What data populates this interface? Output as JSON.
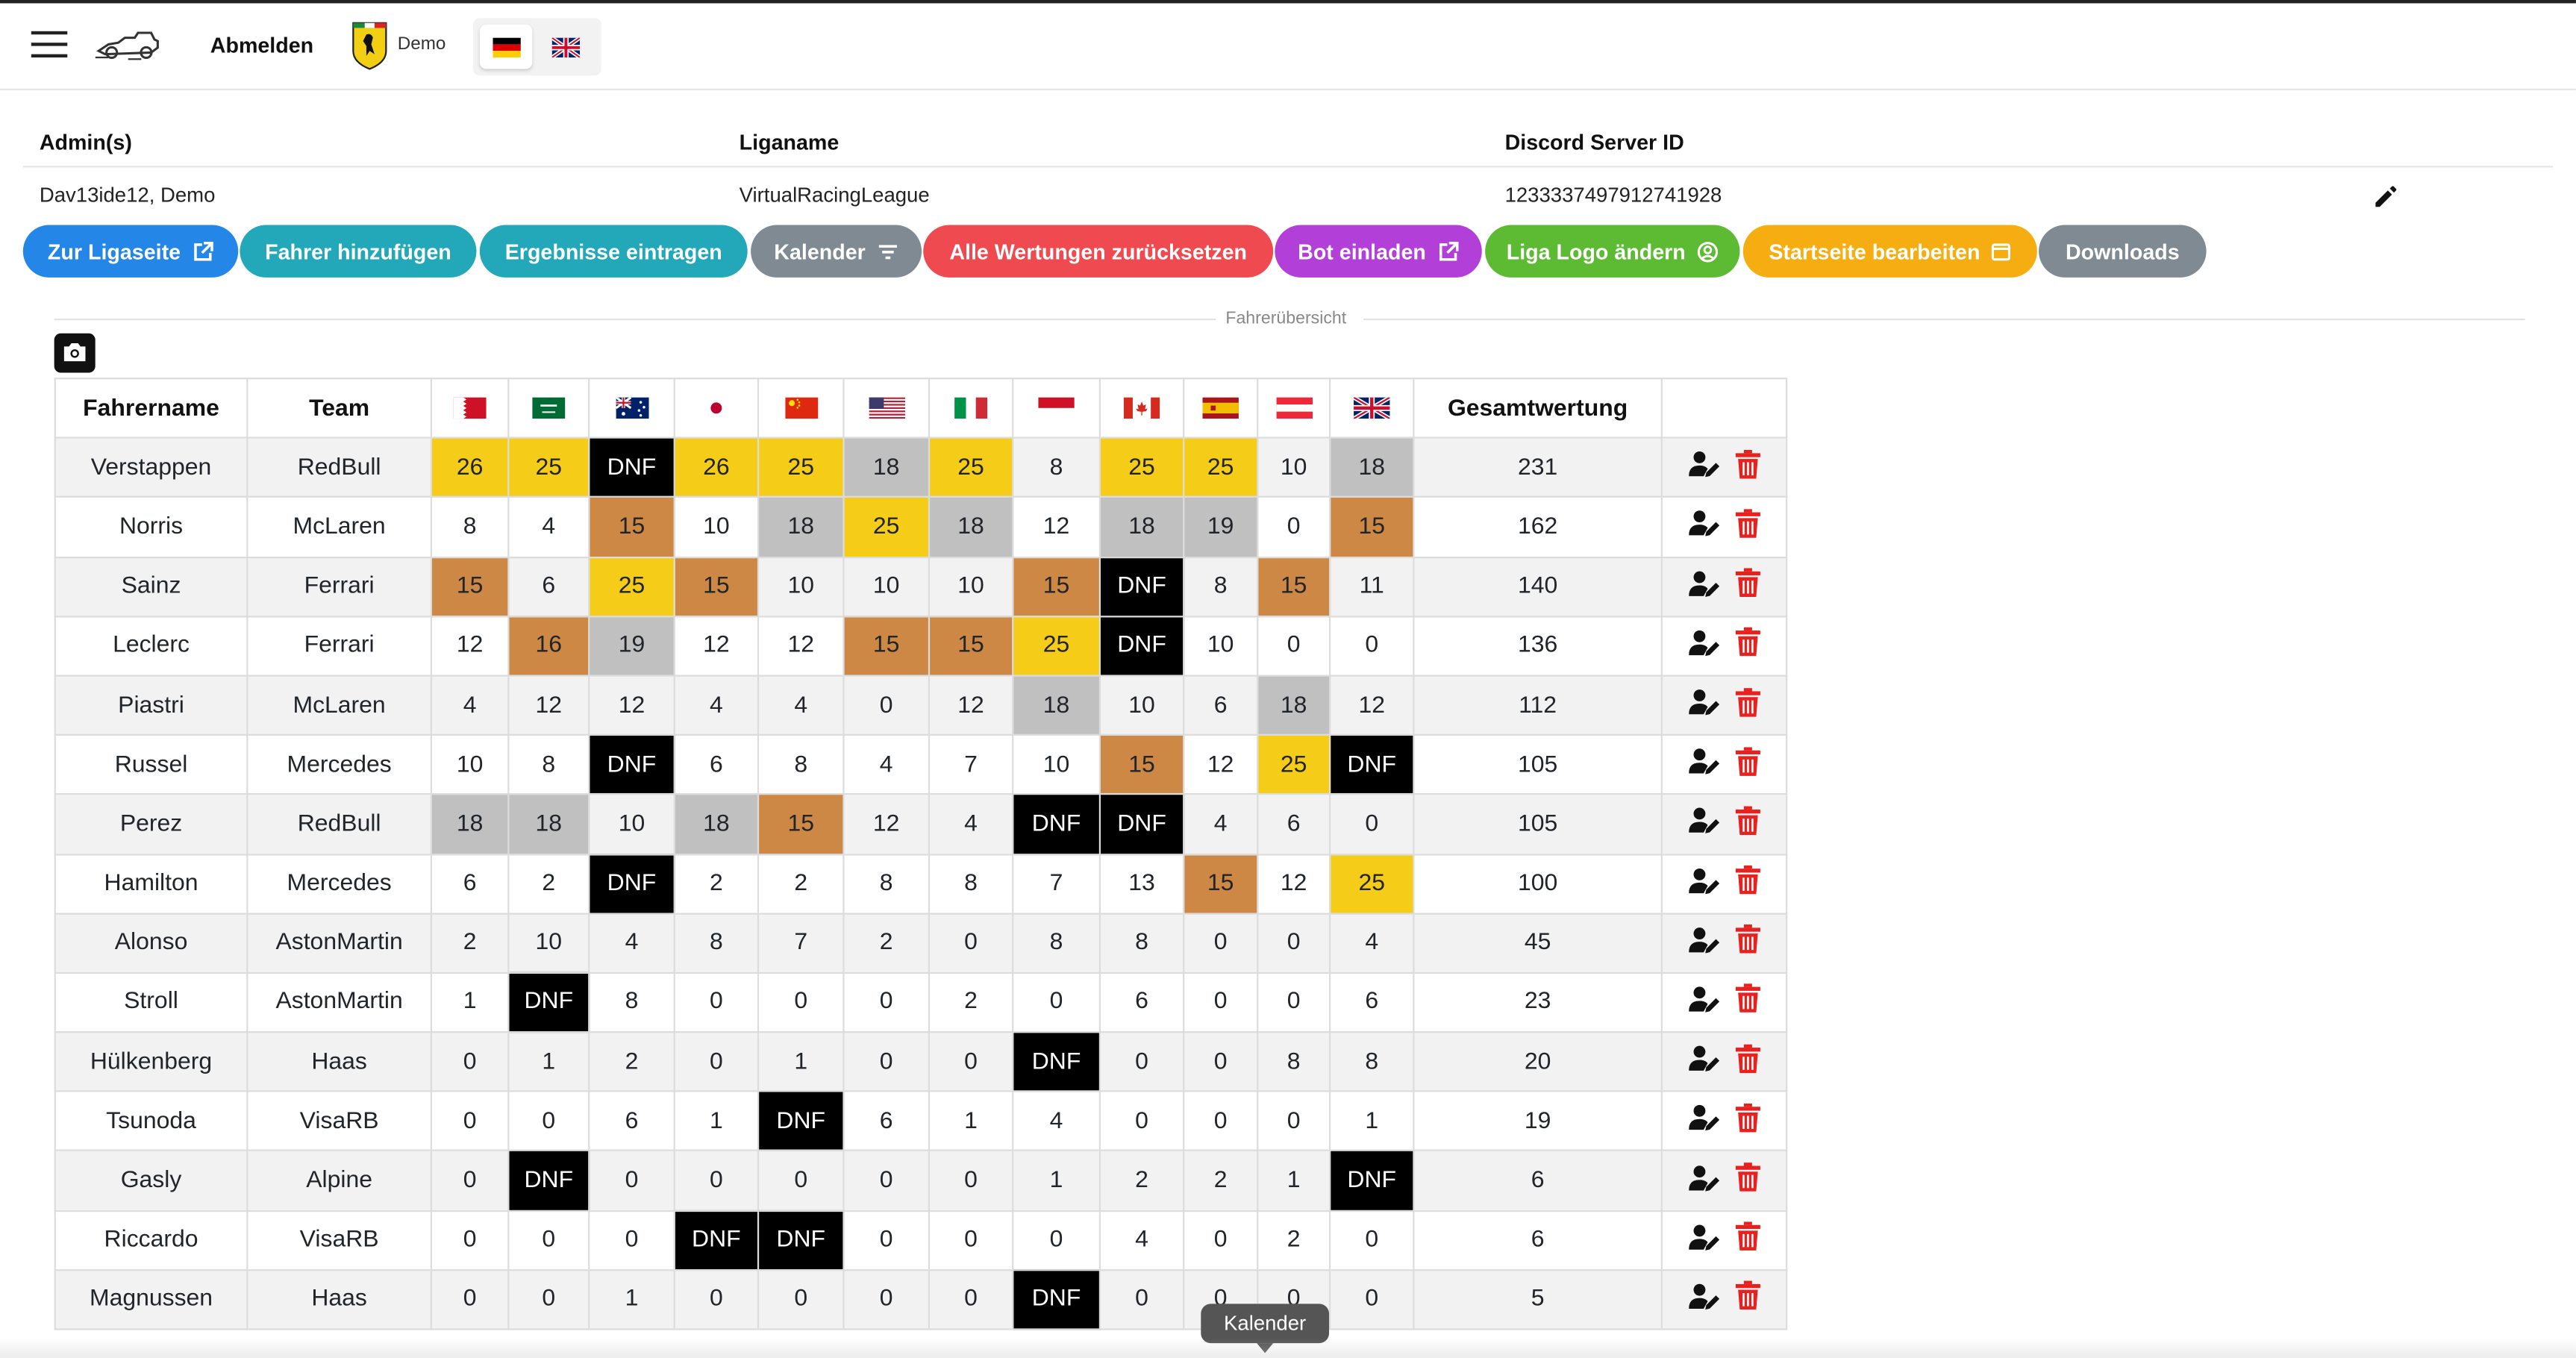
{
  "nav": {
    "logout_label": "Abmelden",
    "user_label": "Demo",
    "languages": [
      "de",
      "en"
    ],
    "active_language": "de"
  },
  "info": {
    "headers": {
      "admins": "Admin(s)",
      "league": "Liganame",
      "discord": "Discord Server ID"
    },
    "values": {
      "admins": "Dav13ide12, Demo",
      "league": "VirtualRacingLeague",
      "discord": "1233337497912741928"
    }
  },
  "buttons": [
    {
      "label": "Zur Ligaseite",
      "color": "#2487e8",
      "icon": "external-link-icon"
    },
    {
      "label": "Fahrer hinzufügen",
      "color": "#22a8b8",
      "icon": ""
    },
    {
      "label": "Ergebnisse eintragen",
      "color": "#22a8b8",
      "icon": ""
    },
    {
      "label": "Kalender",
      "color": "#7f8a93",
      "icon": "filter-icon"
    },
    {
      "label": "Alle Wertungen zurücksetzen",
      "color": "#ef4a4f",
      "icon": ""
    },
    {
      "label": "Bot einladen",
      "color": "#b23fd8",
      "icon": "external-link-icon"
    },
    {
      "label": "Liga Logo ändern",
      "color": "#5cba33",
      "icon": "user-circle-icon"
    },
    {
      "label": "Startseite bearbeiten",
      "color": "#f6ad11",
      "icon": "window-icon"
    },
    {
      "label": "Downloads",
      "color": "#7f8a93",
      "icon": ""
    }
  ],
  "section_title": "Fahrerübersicht",
  "table": {
    "headers": {
      "driver": "Fahrername",
      "team": "Team",
      "total": "Gesamtwertung"
    },
    "races": [
      "bahrain",
      "saudi-arabia",
      "australia",
      "japan",
      "china",
      "usa",
      "italy",
      "monaco",
      "canada",
      "spain",
      "austria",
      "great-britain"
    ],
    "rows": [
      {
        "driver": "Verstappen",
        "team": "RedBull",
        "results": [
          "26",
          "25",
          "DNF",
          "26",
          "25",
          "18",
          "25",
          "8",
          "25",
          "25",
          "10",
          "18"
        ],
        "styles": [
          "g",
          "g",
          "d",
          "g",
          "g",
          "s",
          "g",
          "",
          "g",
          "g",
          "",
          "s"
        ],
        "total": "231"
      },
      {
        "driver": "Norris",
        "team": "McLaren",
        "results": [
          "8",
          "4",
          "15",
          "10",
          "18",
          "25",
          "18",
          "12",
          "18",
          "19",
          "0",
          "15"
        ],
        "styles": [
          "",
          "",
          "b",
          "",
          "s",
          "g",
          "s",
          "",
          "s",
          "s",
          "",
          "b"
        ],
        "total": "162"
      },
      {
        "driver": "Sainz",
        "team": "Ferrari",
        "results": [
          "15",
          "6",
          "25",
          "15",
          "10",
          "10",
          "10",
          "15",
          "DNF",
          "8",
          "15",
          "11"
        ],
        "styles": [
          "b",
          "",
          "g",
          "b",
          "",
          "",
          "",
          "b",
          "d",
          "",
          "b",
          ""
        ],
        "total": "140"
      },
      {
        "driver": "Leclerc",
        "team": "Ferrari",
        "results": [
          "12",
          "16",
          "19",
          "12",
          "12",
          "15",
          "15",
          "25",
          "DNF",
          "10",
          "0",
          "0"
        ],
        "styles": [
          "",
          "b",
          "s",
          "",
          "",
          "b",
          "b",
          "g",
          "d",
          "",
          "",
          ""
        ],
        "total": "136"
      },
      {
        "driver": "Piastri",
        "team": "McLaren",
        "results": [
          "4",
          "12",
          "12",
          "4",
          "4",
          "0",
          "12",
          "18",
          "10",
          "6",
          "18",
          "12"
        ],
        "styles": [
          "",
          "",
          "",
          "",
          "",
          "",
          "",
          "s",
          "",
          "",
          "s",
          ""
        ],
        "total": "112"
      },
      {
        "driver": "Russel",
        "team": "Mercedes",
        "results": [
          "10",
          "8",
          "DNF",
          "6",
          "8",
          "4",
          "7",
          "10",
          "15",
          "12",
          "25",
          "DNF"
        ],
        "styles": [
          "",
          "",
          "d",
          "",
          "",
          "",
          "",
          "",
          "b",
          "",
          "g",
          "d"
        ],
        "total": "105"
      },
      {
        "driver": "Perez",
        "team": "RedBull",
        "results": [
          "18",
          "18",
          "10",
          "18",
          "15",
          "12",
          "4",
          "DNF",
          "DNF",
          "4",
          "6",
          "0"
        ],
        "styles": [
          "s",
          "s",
          "",
          "s",
          "b",
          "",
          "",
          "d",
          "d",
          "",
          "",
          ""
        ],
        "total": "105"
      },
      {
        "driver": "Hamilton",
        "team": "Mercedes",
        "results": [
          "6",
          "2",
          "DNF",
          "2",
          "2",
          "8",
          "8",
          "7",
          "13",
          "15",
          "12",
          "25"
        ],
        "styles": [
          "",
          "",
          "d",
          "",
          "",
          "",
          "",
          "",
          "",
          "b",
          "",
          "g"
        ],
        "total": "100"
      },
      {
        "driver": "Alonso",
        "team": "AstonMartin",
        "results": [
          "2",
          "10",
          "4",
          "8",
          "7",
          "2",
          "0",
          "8",
          "8",
          "0",
          "0",
          "4"
        ],
        "styles": [
          "",
          "",
          "",
          "",
          "",
          "",
          "",
          "",
          "",
          "",
          "",
          ""
        ],
        "total": "45"
      },
      {
        "driver": "Stroll",
        "team": "AstonMartin",
        "results": [
          "1",
          "DNF",
          "8",
          "0",
          "0",
          "0",
          "2",
          "0",
          "6",
          "0",
          "0",
          "6"
        ],
        "styles": [
          "",
          "d",
          "",
          "",
          "",
          "",
          "",
          "",
          "",
          "",
          "",
          ""
        ],
        "total": "23"
      },
      {
        "driver": "Hülkenberg",
        "team": "Haas",
        "results": [
          "0",
          "1",
          "2",
          "0",
          "1",
          "0",
          "0",
          "DNF",
          "0",
          "0",
          "8",
          "8"
        ],
        "styles": [
          "",
          "",
          "",
          "",
          "",
          "",
          "",
          "d",
          "",
          "",
          "",
          ""
        ],
        "total": "20"
      },
      {
        "driver": "Tsunoda",
        "team": "VisaRB",
        "results": [
          "0",
          "0",
          "6",
          "1",
          "DNF",
          "6",
          "1",
          "4",
          "0",
          "0",
          "0",
          "1"
        ],
        "styles": [
          "",
          "",
          "",
          "",
          "d",
          "",
          "",
          "",
          "",
          "",
          "",
          ""
        ],
        "total": "19"
      },
      {
        "driver": "Gasly",
        "team": "Alpine",
        "results": [
          "0",
          "DNF",
          "0",
          "0",
          "0",
          "0",
          "0",
          "1",
          "2",
          "2",
          "1",
          "DNF"
        ],
        "styles": [
          "",
          "d",
          "",
          "",
          "",
          "",
          "",
          "",
          "",
          "",
          "",
          "d"
        ],
        "total": "6"
      },
      {
        "driver": "Riccardo",
        "team": "VisaRB",
        "results": [
          "0",
          "0",
          "0",
          "DNF",
          "DNF",
          "0",
          "0",
          "0",
          "4",
          "0",
          "2",
          "0"
        ],
        "styles": [
          "",
          "",
          "",
          "d",
          "d",
          "",
          "",
          "",
          "",
          "",
          "",
          ""
        ],
        "total": "6"
      },
      {
        "driver": "Magnussen",
        "team": "Haas",
        "results": [
          "0",
          "0",
          "1",
          "0",
          "0",
          "0",
          "0",
          "DNF",
          "0",
          "0",
          "0",
          "0"
        ],
        "styles": [
          "",
          "",
          "",
          "",
          "",
          "",
          "",
          "d",
          "",
          "",
          "",
          ""
        ],
        "total": "5"
      }
    ]
  },
  "tooltip": "Kalender",
  "colors": {
    "gold": "#f5cc18",
    "silver": "#c0c0c0",
    "bronze": "#cc8844",
    "dnf": "#000000",
    "delete": "#e8211f"
  }
}
